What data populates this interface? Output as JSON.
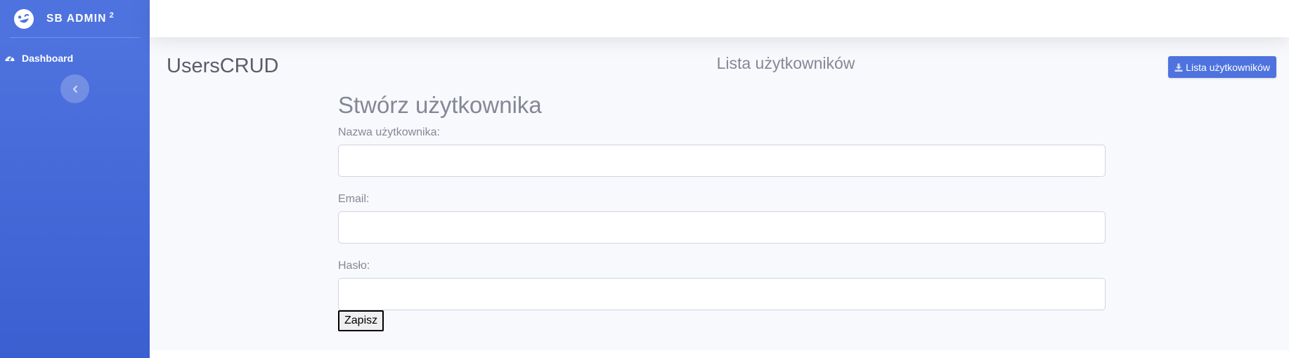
{
  "sidebar": {
    "brand_icon": "laugh-wink-icon",
    "brand_text": "SB ADMIN",
    "brand_sup": "2",
    "nav_items": [
      {
        "label": "Dashboard",
        "icon": "tachometer-icon"
      }
    ],
    "toggle_icon": "chevron-left-icon",
    "gradient_top": "#4e73df",
    "gradient_bottom": "#3b5fd0"
  },
  "header": {
    "app_name": "UsersCRUD",
    "page_heading": "Lista użytkowników",
    "list_button": {
      "label": "Lista użytkowników",
      "icon": "download-icon",
      "color": "#4e73df"
    }
  },
  "form": {
    "title": "Stwórz użytkownika",
    "fields": [
      {
        "label": "Nazwa użytkownika:",
        "value": "",
        "placeholder": ""
      },
      {
        "label": "Email:",
        "value": "",
        "placeholder": ""
      },
      {
        "label": "Hasło:",
        "value": "",
        "placeholder": ""
      }
    ],
    "submit_label": "Zapisz"
  }
}
